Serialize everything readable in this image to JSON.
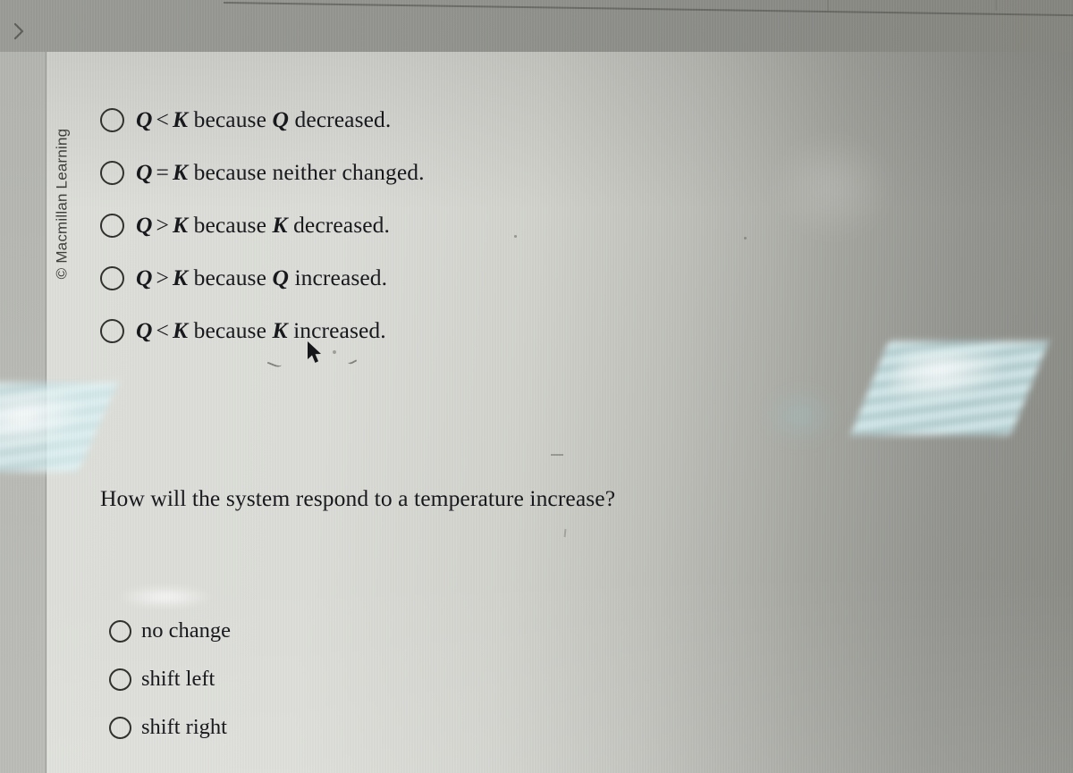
{
  "nav": {
    "chevron_icon": "chevron-right-icon"
  },
  "branding": {
    "copyright": "© Macmillan Learning"
  },
  "question_one": {
    "options": [
      {
        "symbol_left": "Q",
        "operator": "<",
        "symbol_right": "K",
        "reason": "because",
        "reason_var": "Q",
        "reason_tail": "decreased.",
        "full": "Q < K because Q decreased."
      },
      {
        "symbol_left": "Q",
        "operator": "=",
        "symbol_right": "K",
        "reason": "because",
        "reason_var": "",
        "reason_tail": "neither changed.",
        "full": "Q = K because neither changed."
      },
      {
        "symbol_left": "Q",
        "operator": ">",
        "symbol_right": "K",
        "reason": "because",
        "reason_var": "K",
        "reason_tail": "decreased.",
        "full": "Q > K because K decreased."
      },
      {
        "symbol_left": "Q",
        "operator": ">",
        "symbol_right": "K",
        "reason": "because",
        "reason_var": "Q",
        "reason_tail": "increased.",
        "full": "Q > K because Q increased."
      },
      {
        "symbol_left": "Q",
        "operator": "<",
        "symbol_right": "K",
        "reason": "because",
        "reason_var": "K",
        "reason_tail": "increased.",
        "full": "Q < K because K increased."
      }
    ]
  },
  "question_two": {
    "prompt": "How will the system respond to a temperature increase?",
    "options": [
      {
        "label": "no change"
      },
      {
        "label": "shift left"
      },
      {
        "label": "shift right"
      }
    ]
  },
  "colors": {
    "page_background": "#dedfda",
    "surround": "#8c8c87",
    "text": "#15161a",
    "radio_border": "#2f302d",
    "gutter": "#b9bab5",
    "glare": "#e0f7fa"
  }
}
